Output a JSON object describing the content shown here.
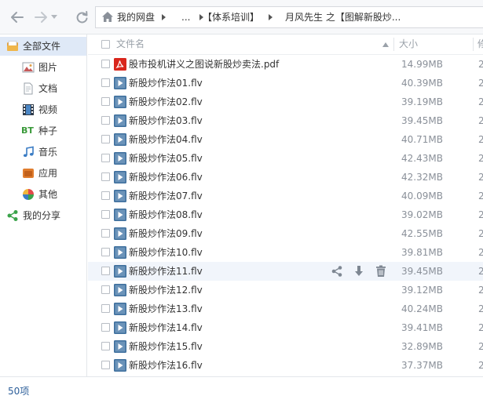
{
  "breadcrumb": {
    "home_label": "我的网盘",
    "ellipsis": "...",
    "folder1": "【体系培训】",
    "folder2": "月风先生 之【图解新股炒..."
  },
  "sidebar": {
    "items": [
      {
        "label": "全部文件",
        "icon": "all-files-icon",
        "active": true
      },
      {
        "label": "图片",
        "icon": "image-icon"
      },
      {
        "label": "文档",
        "icon": "document-icon"
      },
      {
        "label": "视频",
        "icon": "video-icon"
      },
      {
        "label": "种子",
        "icon": "bt-icon",
        "icon_text": "BT"
      },
      {
        "label": "音乐",
        "icon": "music-icon"
      },
      {
        "label": "应用",
        "icon": "app-icon"
      },
      {
        "label": "其他",
        "icon": "other-icon"
      },
      {
        "label": "我的分享",
        "icon": "share-icon"
      }
    ]
  },
  "list": {
    "columns": {
      "name": "文件名",
      "size": "大小",
      "modified_cut": "修"
    },
    "files": [
      {
        "name": "股市投机讲义之图说新股炒卖法.pdf",
        "size": "14.99MB",
        "type": "pdf",
        "date_cut": "2"
      },
      {
        "name": "新股炒作法01.flv",
        "size": "40.39MB",
        "type": "video",
        "date_cut": "2"
      },
      {
        "name": "新股炒作法02.flv",
        "size": "39.19MB",
        "type": "video",
        "date_cut": "2"
      },
      {
        "name": "新股炒作法03.flv",
        "size": "39.45MB",
        "type": "video",
        "date_cut": "2"
      },
      {
        "name": "新股炒作法04.flv",
        "size": "40.71MB",
        "type": "video",
        "date_cut": "2"
      },
      {
        "name": "新股炒作法05.flv",
        "size": "42.43MB",
        "type": "video",
        "date_cut": "2"
      },
      {
        "name": "新股炒作法06.flv",
        "size": "42.32MB",
        "type": "video",
        "date_cut": "2"
      },
      {
        "name": "新股炒作法07.flv",
        "size": "40.09MB",
        "type": "video",
        "date_cut": "2"
      },
      {
        "name": "新股炒作法08.flv",
        "size": "39.02MB",
        "type": "video",
        "date_cut": "2"
      },
      {
        "name": "新股炒作法09.flv",
        "size": "42.55MB",
        "type": "video",
        "date_cut": "2"
      },
      {
        "name": "新股炒作法10.flv",
        "size": "39.81MB",
        "type": "video",
        "date_cut": "2"
      },
      {
        "name": "新股炒作法11.flv",
        "size": "39.45MB",
        "type": "video",
        "date_cut": "2",
        "hover": true
      },
      {
        "name": "新股炒作法12.flv",
        "size": "39.12MB",
        "type": "video",
        "date_cut": "2"
      },
      {
        "name": "新股炒作法13.flv",
        "size": "40.24MB",
        "type": "video",
        "date_cut": "2"
      },
      {
        "name": "新股炒作法14.flv",
        "size": "39.41MB",
        "type": "video",
        "date_cut": "2"
      },
      {
        "name": "新股炒作法15.flv",
        "size": "32.89MB",
        "type": "video",
        "date_cut": "2"
      },
      {
        "name": "新股炒作法16.flv",
        "size": "37.37MB",
        "type": "video",
        "date_cut": "2"
      }
    ]
  },
  "status": {
    "count": "50项"
  },
  "colors": {
    "accent": "#2d5f9a",
    "active_bg": "#dfe9f7",
    "hover_bg": "#f1f5fb",
    "pdf_red": "#d9261c",
    "video_blue": "#3e6f9d"
  }
}
